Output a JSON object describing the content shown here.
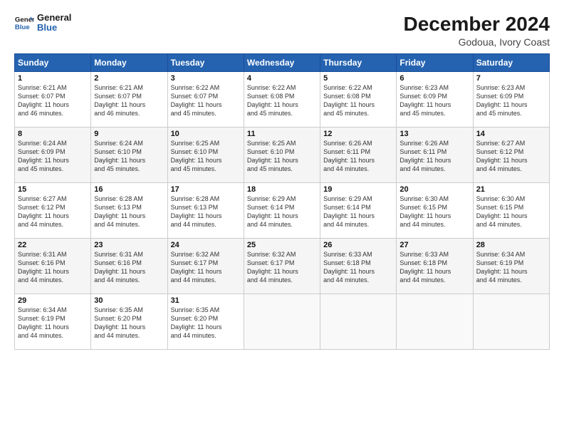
{
  "logo": {
    "line1": "General",
    "line2": "Blue"
  },
  "title": "December 2024",
  "subtitle": "Godoua, Ivory Coast",
  "weekdays": [
    "Sunday",
    "Monday",
    "Tuesday",
    "Wednesday",
    "Thursday",
    "Friday",
    "Saturday"
  ],
  "weeks": [
    [
      {
        "day": "1",
        "info": "Sunrise: 6:21 AM\nSunset: 6:07 PM\nDaylight: 11 hours\nand 46 minutes."
      },
      {
        "day": "2",
        "info": "Sunrise: 6:21 AM\nSunset: 6:07 PM\nDaylight: 11 hours\nand 46 minutes."
      },
      {
        "day": "3",
        "info": "Sunrise: 6:22 AM\nSunset: 6:07 PM\nDaylight: 11 hours\nand 45 minutes."
      },
      {
        "day": "4",
        "info": "Sunrise: 6:22 AM\nSunset: 6:08 PM\nDaylight: 11 hours\nand 45 minutes."
      },
      {
        "day": "5",
        "info": "Sunrise: 6:22 AM\nSunset: 6:08 PM\nDaylight: 11 hours\nand 45 minutes."
      },
      {
        "day": "6",
        "info": "Sunrise: 6:23 AM\nSunset: 6:09 PM\nDaylight: 11 hours\nand 45 minutes."
      },
      {
        "day": "7",
        "info": "Sunrise: 6:23 AM\nSunset: 6:09 PM\nDaylight: 11 hours\nand 45 minutes."
      }
    ],
    [
      {
        "day": "8",
        "info": "Sunrise: 6:24 AM\nSunset: 6:09 PM\nDaylight: 11 hours\nand 45 minutes."
      },
      {
        "day": "9",
        "info": "Sunrise: 6:24 AM\nSunset: 6:10 PM\nDaylight: 11 hours\nand 45 minutes."
      },
      {
        "day": "10",
        "info": "Sunrise: 6:25 AM\nSunset: 6:10 PM\nDaylight: 11 hours\nand 45 minutes."
      },
      {
        "day": "11",
        "info": "Sunrise: 6:25 AM\nSunset: 6:10 PM\nDaylight: 11 hours\nand 45 minutes."
      },
      {
        "day": "12",
        "info": "Sunrise: 6:26 AM\nSunset: 6:11 PM\nDaylight: 11 hours\nand 44 minutes."
      },
      {
        "day": "13",
        "info": "Sunrise: 6:26 AM\nSunset: 6:11 PM\nDaylight: 11 hours\nand 44 minutes."
      },
      {
        "day": "14",
        "info": "Sunrise: 6:27 AM\nSunset: 6:12 PM\nDaylight: 11 hours\nand 44 minutes."
      }
    ],
    [
      {
        "day": "15",
        "info": "Sunrise: 6:27 AM\nSunset: 6:12 PM\nDaylight: 11 hours\nand 44 minutes."
      },
      {
        "day": "16",
        "info": "Sunrise: 6:28 AM\nSunset: 6:13 PM\nDaylight: 11 hours\nand 44 minutes."
      },
      {
        "day": "17",
        "info": "Sunrise: 6:28 AM\nSunset: 6:13 PM\nDaylight: 11 hours\nand 44 minutes."
      },
      {
        "day": "18",
        "info": "Sunrise: 6:29 AM\nSunset: 6:14 PM\nDaylight: 11 hours\nand 44 minutes."
      },
      {
        "day": "19",
        "info": "Sunrise: 6:29 AM\nSunset: 6:14 PM\nDaylight: 11 hours\nand 44 minutes."
      },
      {
        "day": "20",
        "info": "Sunrise: 6:30 AM\nSunset: 6:15 PM\nDaylight: 11 hours\nand 44 minutes."
      },
      {
        "day": "21",
        "info": "Sunrise: 6:30 AM\nSunset: 6:15 PM\nDaylight: 11 hours\nand 44 minutes."
      }
    ],
    [
      {
        "day": "22",
        "info": "Sunrise: 6:31 AM\nSunset: 6:16 PM\nDaylight: 11 hours\nand 44 minutes."
      },
      {
        "day": "23",
        "info": "Sunrise: 6:31 AM\nSunset: 6:16 PM\nDaylight: 11 hours\nand 44 minutes."
      },
      {
        "day": "24",
        "info": "Sunrise: 6:32 AM\nSunset: 6:17 PM\nDaylight: 11 hours\nand 44 minutes."
      },
      {
        "day": "25",
        "info": "Sunrise: 6:32 AM\nSunset: 6:17 PM\nDaylight: 11 hours\nand 44 minutes."
      },
      {
        "day": "26",
        "info": "Sunrise: 6:33 AM\nSunset: 6:18 PM\nDaylight: 11 hours\nand 44 minutes."
      },
      {
        "day": "27",
        "info": "Sunrise: 6:33 AM\nSunset: 6:18 PM\nDaylight: 11 hours\nand 44 minutes."
      },
      {
        "day": "28",
        "info": "Sunrise: 6:34 AM\nSunset: 6:19 PM\nDaylight: 11 hours\nand 44 minutes."
      }
    ],
    [
      {
        "day": "29",
        "info": "Sunrise: 6:34 AM\nSunset: 6:19 PM\nDaylight: 11 hours\nand 44 minutes."
      },
      {
        "day": "30",
        "info": "Sunrise: 6:35 AM\nSunset: 6:20 PM\nDaylight: 11 hours\nand 44 minutes."
      },
      {
        "day": "31",
        "info": "Sunrise: 6:35 AM\nSunset: 6:20 PM\nDaylight: 11 hours\nand 44 minutes."
      },
      null,
      null,
      null,
      null
    ]
  ]
}
